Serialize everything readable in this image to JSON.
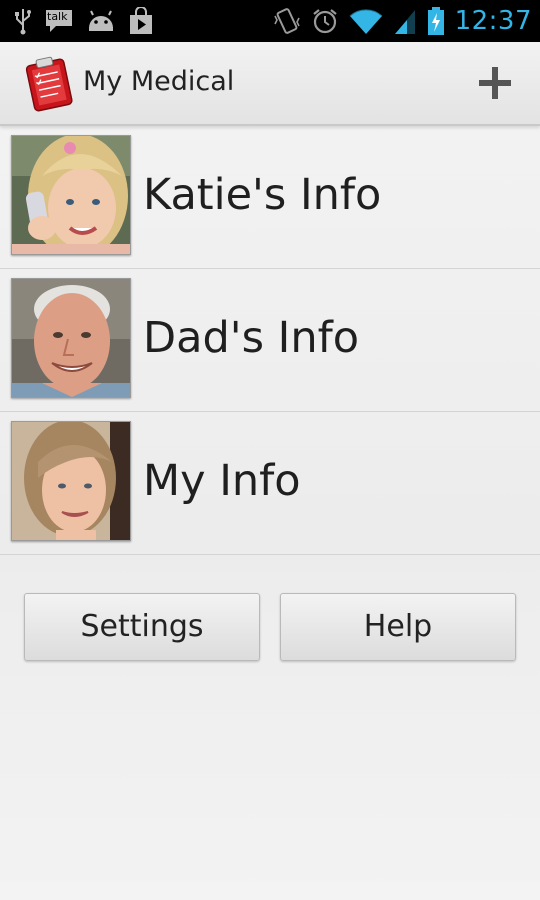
{
  "status_bar": {
    "time": "12:37",
    "notifications": [
      "usb-icon",
      "talk-icon",
      "android-icon",
      "play-store-icon"
    ],
    "talk_label": "talk",
    "system": [
      "vibrate-icon",
      "alarm-icon",
      "wifi-icon",
      "signal-icon",
      "battery-charging-icon"
    ],
    "accent_color": "#33b5e5"
  },
  "action_bar": {
    "title": "My Medical",
    "app_icon": "clipboard-icon",
    "action": "add-icon"
  },
  "profiles": [
    {
      "label": "Katie's Info",
      "photo": "child-photo"
    },
    {
      "label": "Dad's Info",
      "photo": "older-man-photo"
    },
    {
      "label": "My Info",
      "photo": "woman-photo"
    }
  ],
  "buttons": {
    "settings": "Settings",
    "help": "Help"
  }
}
